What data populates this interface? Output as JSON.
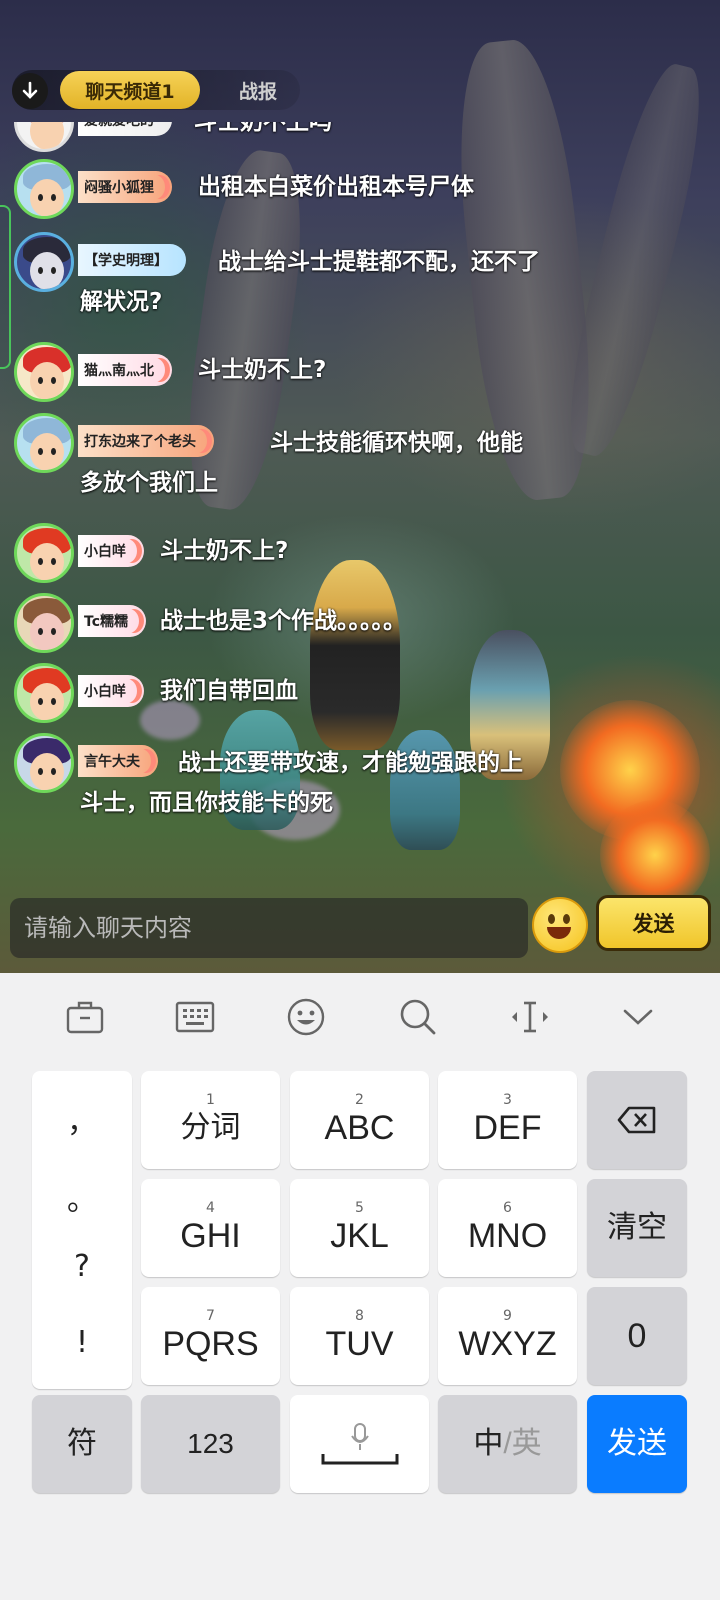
{
  "tabs": {
    "active": "聊天频道1",
    "inactive": "战报"
  },
  "messages": [
    {
      "name": "爱就爱吧的",
      "text": "斗士奶不上吗"
    },
    {
      "name": "闷骚小狐狸",
      "text": "出租本白菜价出租本号尸体"
    },
    {
      "name": "【学史明理】",
      "text": "战士给斗士提鞋都不配，还不了解状况?"
    },
    {
      "name": "猫灬南灬北",
      "text": "斗士奶不上?"
    },
    {
      "name": "打东边来了个老头",
      "text": "斗士技能循环快啊，他能多放个我们上"
    },
    {
      "name": "小白咩",
      "text": "斗士奶不上?"
    },
    {
      "name": "Tc糯糯",
      "text": "战士也是3个作战。。。。。"
    },
    {
      "name": "小白咩",
      "text": "我们自带回血"
    },
    {
      "name": "言午大夫",
      "text": "战士还要带攻速，才能勉强跟的上斗士，而且你技能卡的死"
    }
  ],
  "input": {
    "placeholder": "请输入聊天内容"
  },
  "game_send": "发送",
  "toolbar_icons": [
    "toolbox-icon",
    "keyboard-icon",
    "emoji-icon",
    "search-icon",
    "cursor-icon",
    "collapse-icon"
  ],
  "keyboard": {
    "punct": [
      "，",
      "。",
      "?",
      "!"
    ],
    "keys": [
      {
        "num": "1",
        "label": "分词"
      },
      {
        "num": "2",
        "label": "ABC"
      },
      {
        "num": "3",
        "label": "DEF"
      },
      {
        "num": "4",
        "label": "GHI"
      },
      {
        "num": "5",
        "label": "JKL"
      },
      {
        "num": "6",
        "label": "MNO"
      },
      {
        "num": "7",
        "label": "PQRS"
      },
      {
        "num": "8",
        "label": "TUV"
      },
      {
        "num": "9",
        "label": "WXYZ"
      }
    ],
    "clear": "清空",
    "zero": "0",
    "symbol": "符",
    "num123": "123",
    "lang_cn": "中",
    "lang_sep": "/英",
    "send": "发送"
  },
  "colors": {
    "accent": "#0a7cff",
    "tab_active": "#f6d257",
    "avatar_ring": "#6fd85a"
  }
}
